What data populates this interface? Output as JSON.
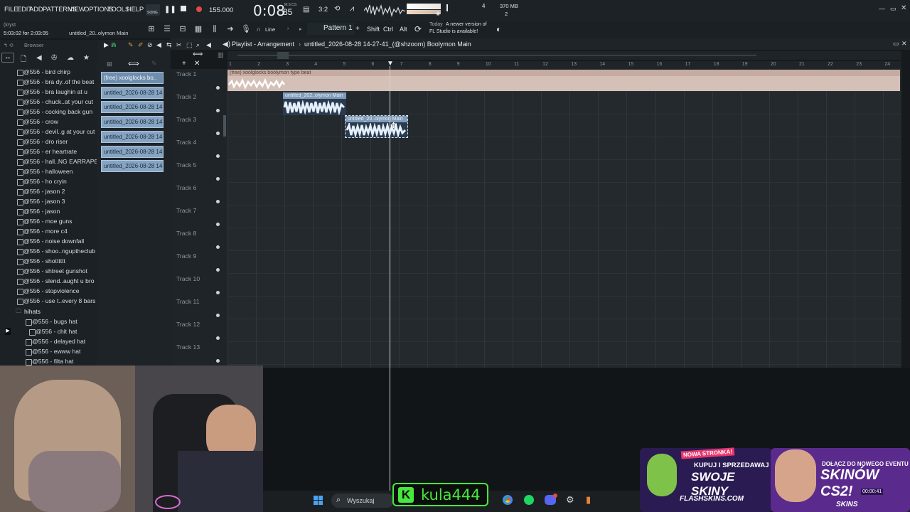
{
  "menu": {
    "items": [
      "FILE",
      "EDIT",
      "ADD",
      "PATTERNS",
      "VIEW",
      "OPTIONS",
      "TOOLS",
      "HELP"
    ],
    "song_mode": "SONG",
    "tempo": "155.000",
    "time": "0:08",
    "time_ms": "85",
    "msc_label": "M:S:CS",
    "beats_label": "3:2",
    "counter": "4",
    "memory": "370 MB",
    "memory_sub": "2"
  },
  "hint": {
    "user": "(kryst",
    "timestamp": "5:03:02 for 2:03:05",
    "project_label": "untitled_20..olymon Main",
    "line_mode": "Line",
    "pattern": "Pattern 1",
    "keys": [
      "Shift",
      "Ctrl",
      "Alt"
    ],
    "update_today": "Today",
    "update_text": "A newer version of",
    "update_text2": "FL Studio is available!"
  },
  "browser": {
    "title": "Browser",
    "items": [
      "@556 - bird chirp",
      "@556 - bra dy..of the beat",
      "@556 - bra laughin at u",
      "@556 - chuck..at your cut",
      "@556 - cocking back gun",
      "@556 - crow",
      "@556 - devil..g at your cut",
      "@556 - dro riser",
      "@556 - er heartrate",
      "@556 - hall..NG EARRAPE)",
      "@556 - halloween",
      "@556 - ho cryin",
      "@556 - jason 2",
      "@556 - jason 3",
      "@556 - jason",
      "@556 - moe guns",
      "@556 - more c4",
      "@556 - noise downfall",
      "@556 - shoo..nguptheclub",
      "@556 - shotttttt",
      "@556 - shtreet gunshot",
      "@556 - slend..aught u bro",
      "@556 - stopviolence",
      "@556 - use t..every 8 bars"
    ],
    "folder": "hihats",
    "sub_items": [
      "@556 - bugs hat",
      "@556 - chit hat",
      "@556 - delayed hat",
      "@556 - ewww hat",
      "@556 - filta hat"
    ]
  },
  "picker": {
    "clips": [
      "(free) xoolglocks bo..",
      "untitled_2026-08-28 14-",
      "untitled_2026-08-28 14-",
      "untitled_2026-08-28 14-",
      "untitled_2026-08-28 14-",
      "untitled_2026-08-28 14-",
      "untitled_2026-08-28 14-"
    ]
  },
  "playlist": {
    "title_prefix": "Playlist - Arrangement",
    "title_project": "untitled_2026-08-28 14-27-41_(@shzoom) Boolymon Main",
    "tracks": [
      "Track 1",
      "Track 2",
      "Track 3",
      "Track 4",
      "Track 5",
      "Track 6",
      "Track 7",
      "Track 8",
      "Track 9",
      "Track 10",
      "Track 11",
      "Track 12",
      "Track 13"
    ],
    "ruler": [
      "1",
      "2",
      "3",
      "4",
      "5",
      "6",
      "7",
      "8",
      "9",
      "10",
      "11",
      "12",
      "13",
      "14",
      "15",
      "16",
      "17",
      "18",
      "19",
      "20",
      "21",
      "22",
      "23",
      "24"
    ],
    "clip1": "(free) xoolglocks boolymon type beat",
    "clip2": "untitled_202..olymon Main",
    "clip3": "untitled_20..olymon Main"
  },
  "taskbar": {
    "search": "Wyszukaj"
  },
  "overlay": {
    "streamer": "kula444",
    "ad1_tag": "NOWA STRONKA!",
    "ad1_line1": "KUPUJ I SPRZEDAWAJ",
    "ad1_line2": "SWOJE SKINY",
    "ad1_brand": "FLASHSKINS.COM",
    "ad2_line1": "DOŁĄCZ DO NOWEGO EVENTU",
    "ad2_line2": "SKINÓW CS2!",
    "ad2_timer": "00:00:41",
    "ad2_brand": "SKINS"
  },
  "colors": {
    "accent_green": "#46e83c",
    "clip_blue": "#86a4c2",
    "clip_peach": "#d9c3bc"
  }
}
